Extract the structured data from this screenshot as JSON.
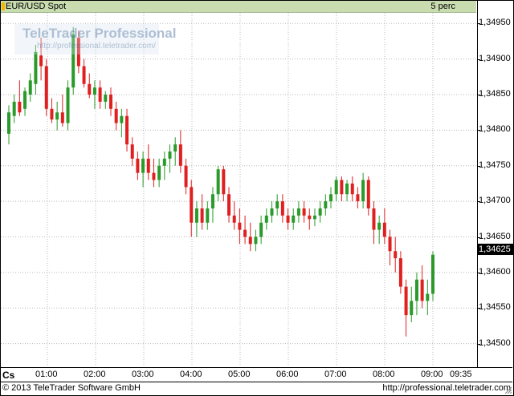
{
  "header": {
    "symbol": "EUR/USD Spot",
    "interval": "5 perc"
  },
  "watermark": {
    "brand": "TeleTrader Professional",
    "url": "http://professional.teletrader.com/"
  },
  "last_price_label": "1,34625",
  "footer": {
    "copyright": "© 2013 TeleTrader Software GmbH",
    "url": "http://professional.teletrader.com"
  },
  "xaxis": {
    "chart_style_label": "Cs"
  },
  "colors": {
    "up": "#2a9a2a",
    "down": "#e02020",
    "header_bg": "#c8dcb0",
    "grid": "#b8b8b8"
  },
  "chart_data": {
    "type": "candlestick",
    "x_ticks": [
      "01:00",
      "02:00",
      "03:00",
      "04:00",
      "05:00",
      "06:00",
      "07:00",
      "08:00",
      "09:00",
      "09:35"
    ],
    "y_ticks": [
      "1,34950",
      "1,34900",
      "1,34850",
      "1,34800",
      "1,34750",
      "1,34700",
      "1,34650",
      "1,34600",
      "1,34550",
      "1,34500"
    ],
    "y_tick_values": [
      1.3495,
      1.349,
      1.3485,
      1.348,
      1.3475,
      1.347,
      1.3465,
      1.346,
      1.3455,
      1.345
    ],
    "ylim": [
      1.34468,
      1.34965
    ],
    "grid": true,
    "candles": [
      [
        1.34795,
        1.34835,
        1.3478,
        1.34825
      ],
      [
        1.3482,
        1.3485,
        1.3481,
        1.3484
      ],
      [
        1.3484,
        1.3487,
        1.3482,
        1.34825
      ],
      [
        1.3483,
        1.3486,
        1.3482,
        1.34855
      ],
      [
        1.3485,
        1.3488,
        1.3484,
        1.3487
      ],
      [
        1.34865,
        1.3492,
        1.3485,
        1.3491
      ],
      [
        1.34905,
        1.3493,
        1.3487,
        1.3489
      ],
      [
        1.3489,
        1.349,
        1.3482,
        1.3483
      ],
      [
        1.3483,
        1.34845,
        1.3481,
        1.34815
      ],
      [
        1.34815,
        1.3484,
        1.348,
        1.34825
      ],
      [
        1.34825,
        1.3485,
        1.34805,
        1.3481
      ],
      [
        1.3481,
        1.3487,
        1.348,
        1.3486
      ],
      [
        1.3486,
        1.34945,
        1.3485,
        1.34935
      ],
      [
        1.3493,
        1.3494,
        1.3488,
        1.3489
      ],
      [
        1.3489,
        1.349,
        1.3486,
        1.34865
      ],
      [
        1.34865,
        1.3488,
        1.34845,
        1.3485
      ],
      [
        1.3485,
        1.3487,
        1.3483,
        1.3486
      ],
      [
        1.3486,
        1.3487,
        1.3483,
        1.3484
      ],
      [
        1.3484,
        1.34855,
        1.3483,
        1.3485
      ],
      [
        1.3485,
        1.3486,
        1.3482,
        1.3483
      ],
      [
        1.3483,
        1.3484,
        1.348,
        1.3481
      ],
      [
        1.3481,
        1.3483,
        1.3479,
        1.3482
      ],
      [
        1.3482,
        1.3483,
        1.3477,
        1.3478
      ],
      [
        1.3478,
        1.3479,
        1.3475,
        1.3476
      ],
      [
        1.3476,
        1.3477,
        1.3473,
        1.3474
      ],
      [
        1.3474,
        1.3477,
        1.3472,
        1.3476
      ],
      [
        1.3476,
        1.3478,
        1.3473,
        1.3474
      ],
      [
        1.3474,
        1.3476,
        1.3472,
        1.3473
      ],
      [
        1.3473,
        1.3476,
        1.3472,
        1.3475
      ],
      [
        1.3475,
        1.3477,
        1.3473,
        1.3476
      ],
      [
        1.3476,
        1.3478,
        1.3474,
        1.3477
      ],
      [
        1.3477,
        1.3479,
        1.3475,
        1.3478
      ],
      [
        1.3478,
        1.348,
        1.3474,
        1.3475
      ],
      [
        1.3475,
        1.3476,
        1.3471,
        1.3472
      ],
      [
        1.3472,
        1.3473,
        1.3465,
        1.3467
      ],
      [
        1.3467,
        1.347,
        1.3465,
        1.3469
      ],
      [
        1.3469,
        1.3471,
        1.3466,
        1.3467
      ],
      [
        1.3467,
        1.347,
        1.3466,
        1.3469
      ],
      [
        1.3469,
        1.3472,
        1.3467,
        1.3471
      ],
      [
        1.3471,
        1.3475,
        1.347,
        1.34745
      ],
      [
        1.34745,
        1.3475,
        1.347,
        1.3471
      ],
      [
        1.3471,
        1.3472,
        1.3467,
        1.3468
      ],
      [
        1.3468,
        1.347,
        1.3466,
        1.3467
      ],
      [
        1.3467,
        1.3469,
        1.3464,
        1.3466
      ],
      [
        1.3466,
        1.3468,
        1.3464,
        1.3465
      ],
      [
        1.3465,
        1.3467,
        1.3463,
        1.3464
      ],
      [
        1.3464,
        1.3466,
        1.3463,
        1.3465
      ],
      [
        1.3465,
        1.3468,
        1.3464,
        1.3467
      ],
      [
        1.3467,
        1.3469,
        1.3466,
        1.3468
      ],
      [
        1.3468,
        1.347,
        1.3467,
        1.3469
      ],
      [
        1.3469,
        1.3471,
        1.3468,
        1.347
      ],
      [
        1.347,
        1.3471,
        1.3467,
        1.3468
      ],
      [
        1.3468,
        1.3469,
        1.3466,
        1.3467
      ],
      [
        1.3467,
        1.3469,
        1.3466,
        1.3468
      ],
      [
        1.3468,
        1.347,
        1.3467,
        1.3469
      ],
      [
        1.3469,
        1.347,
        1.3467,
        1.3468
      ],
      [
        1.3468,
        1.3469,
        1.3466,
        1.34675
      ],
      [
        1.34675,
        1.3469,
        1.34665,
        1.3468
      ],
      [
        1.3468,
        1.347,
        1.3467,
        1.3469
      ],
      [
        1.3469,
        1.3471,
        1.3468,
        1.347
      ],
      [
        1.347,
        1.3472,
        1.3469,
        1.3471
      ],
      [
        1.3471,
        1.34735,
        1.347,
        1.3473
      ],
      [
        1.3473,
        1.34735,
        1.347,
        1.3471
      ],
      [
        1.3471,
        1.3473,
        1.347,
        1.34725
      ],
      [
        1.34725,
        1.34735,
        1.347,
        1.3471
      ],
      [
        1.3471,
        1.3472,
        1.3469,
        1.347
      ],
      [
        1.347,
        1.3474,
        1.3469,
        1.3473
      ],
      [
        1.3473,
        1.34735,
        1.3468,
        1.3469
      ],
      [
        1.3469,
        1.347,
        1.3464,
        1.3466
      ],
      [
        1.3466,
        1.3468,
        1.3464,
        1.3467
      ],
      [
        1.3467,
        1.3469,
        1.3464,
        1.3465
      ],
      [
        1.3465,
        1.3466,
        1.3461,
        1.3463
      ],
      [
        1.3463,
        1.3465,
        1.346,
        1.3462
      ],
      [
        1.3462,
        1.3463,
        1.3457,
        1.3458
      ],
      [
        1.3458,
        1.3459,
        1.3451,
        1.3454
      ],
      [
        1.3454,
        1.3458,
        1.3453,
        1.3456
      ],
      [
        1.3456,
        1.346,
        1.3454,
        1.3459
      ],
      [
        1.3459,
        1.3461,
        1.3455,
        1.3456
      ],
      [
        1.3456,
        1.3459,
        1.3454,
        1.3457
      ],
      [
        1.3457,
        1.3463,
        1.3456,
        1.34625
      ]
    ]
  }
}
